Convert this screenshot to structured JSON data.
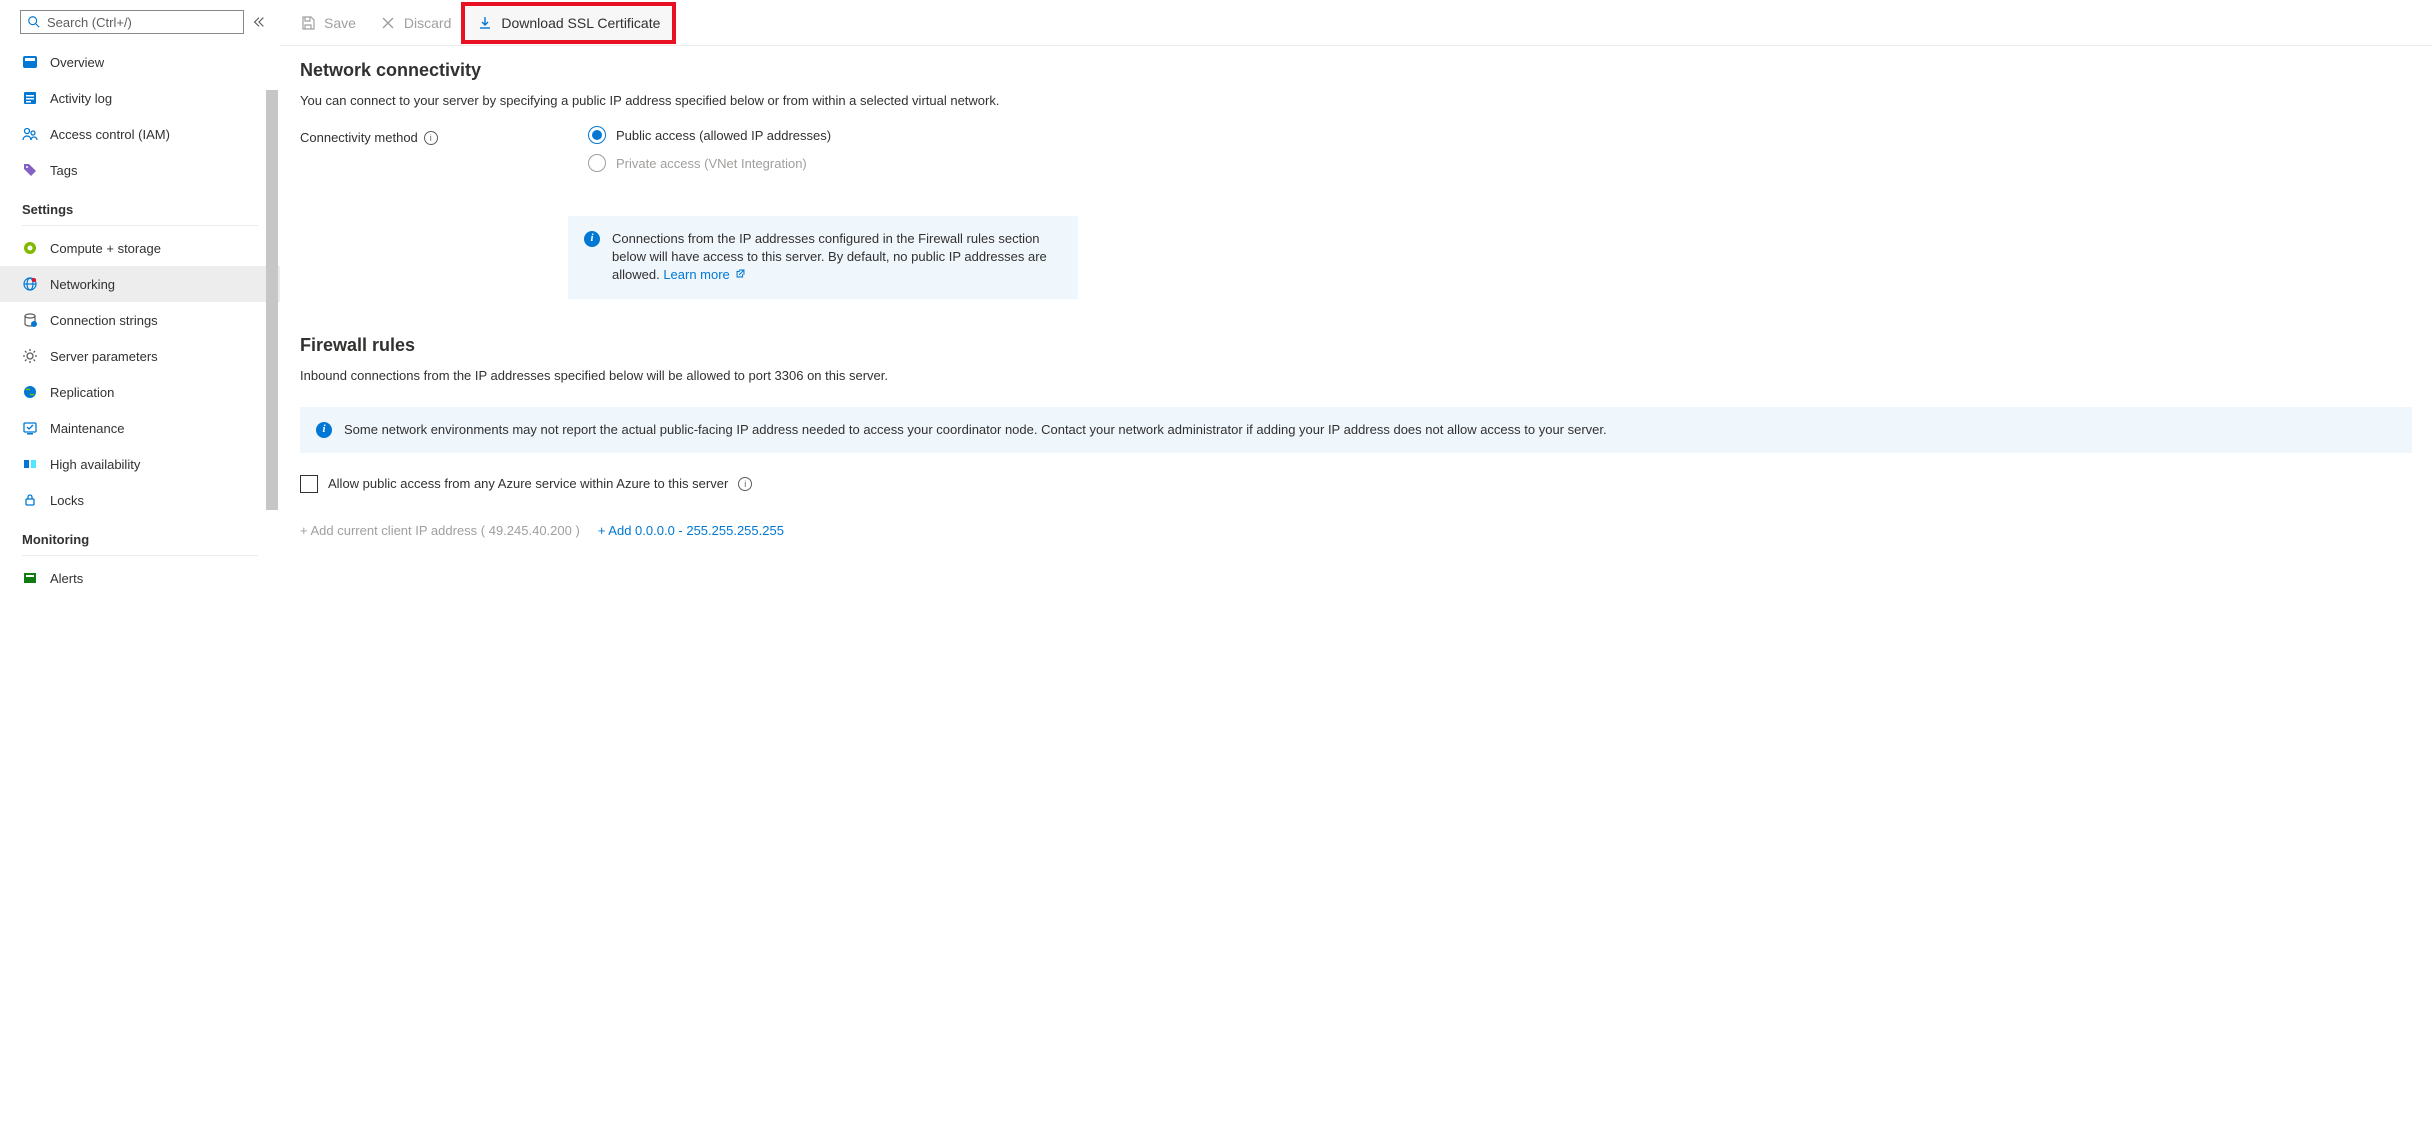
{
  "sidebar": {
    "search_placeholder": "Search (Ctrl+/)",
    "items_top": [
      {
        "label": "Overview"
      },
      {
        "label": "Activity log"
      },
      {
        "label": "Access control (IAM)"
      },
      {
        "label": "Tags"
      }
    ],
    "section_settings": "Settings",
    "items_settings": [
      {
        "label": "Compute + storage"
      },
      {
        "label": "Networking"
      },
      {
        "label": "Connection strings"
      },
      {
        "label": "Server parameters"
      },
      {
        "label": "Replication"
      },
      {
        "label": "Maintenance"
      },
      {
        "label": "High availability"
      },
      {
        "label": "Locks"
      }
    ],
    "section_monitoring": "Monitoring",
    "items_monitoring": [
      {
        "label": "Alerts"
      }
    ]
  },
  "toolbar": {
    "save": "Save",
    "discard": "Discard",
    "download": "Download SSL Certificate"
  },
  "network": {
    "title": "Network connectivity",
    "desc": "You can connect to your server by specifying a public IP address specified below or from within a selected virtual network.",
    "method_label": "Connectivity method",
    "opt_public": "Public access (allowed IP addresses)",
    "opt_private": "Private access (VNet Integration)",
    "info_text": "Connections from the IP addresses configured in the Firewall rules section below will have access to this server. By default, no public IP addresses are allowed. ",
    "learn_more": "Learn more"
  },
  "firewall": {
    "title": "Firewall rules",
    "desc": "Inbound connections from the IP addresses specified below will be allowed to port 3306 on this server.",
    "note": "Some network environments may not report the actual public-facing IP address needed to access your coordinator node. Contact your network administrator if adding your IP address does not allow access to your server.",
    "allow_any": "Allow public access from any Azure service within Azure to this server",
    "add_client": "+ Add current client IP address ( 49.245.40.200 )",
    "add_range": "+ Add 0.0.0.0 - 255.255.255.255"
  }
}
